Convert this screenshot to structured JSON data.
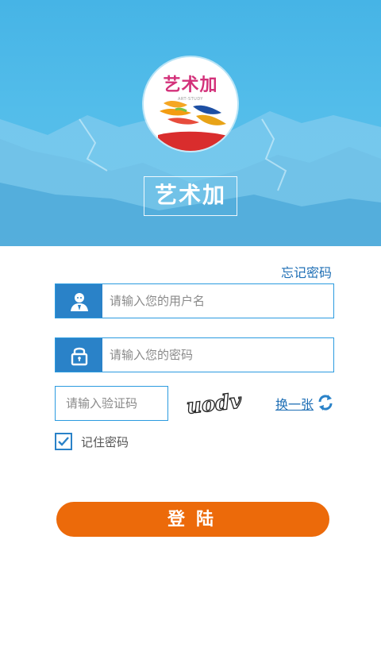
{
  "header": {
    "logo_text": "艺术加",
    "logo_subtext": "ART-STUDY",
    "app_title": "艺术加"
  },
  "login": {
    "forgot_password": "忘记密码",
    "username_placeholder": "请输入您的用户名",
    "password_placeholder": "请输入您的密码",
    "captcha_placeholder": "请输入验证码",
    "captcha_text": "uodv",
    "refresh_captcha": "换一张",
    "remember_label": "记住密码",
    "remember_checked": true,
    "submit_label": "登陆"
  },
  "colors": {
    "accent_blue": "#2a82c8",
    "border_blue": "#2b9be0",
    "button_orange": "#ec6a0a",
    "sky": "#46b4e6"
  },
  "icons": [
    "user-icon",
    "lock-icon",
    "refresh-icon",
    "check-icon"
  ]
}
